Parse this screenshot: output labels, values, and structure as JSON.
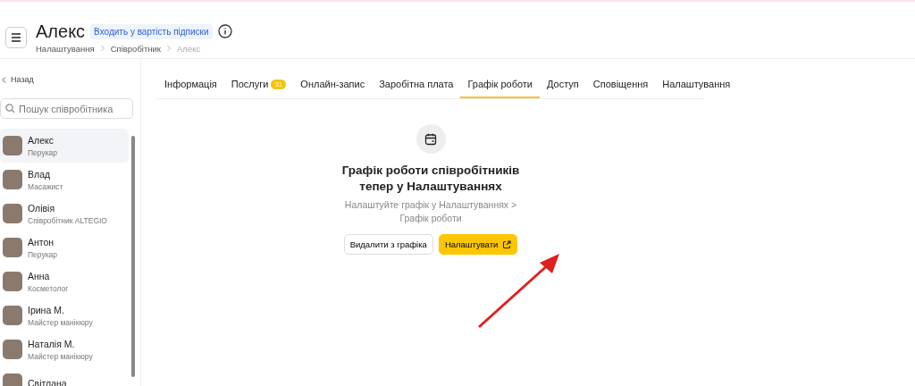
{
  "header": {
    "title": "Алекс",
    "badge": "Входить у вартість підписки",
    "breadcrumbs": [
      "Налаштування",
      "Співробітник",
      "Алекс"
    ]
  },
  "sidebar": {
    "back": "Назад",
    "search": {
      "placeholder": "Пошук співробітника"
    },
    "items": [
      {
        "name": "Алекс",
        "role": "Перукар",
        "selected": true
      },
      {
        "name": "Влад",
        "role": "Масажист",
        "selected": false
      },
      {
        "name": "Олівія",
        "role": "Співробітник ALTEGIO",
        "selected": false
      },
      {
        "name": "Антон",
        "role": "Перукар",
        "selected": false
      },
      {
        "name": "Анна",
        "role": "Косметолог",
        "selected": false
      },
      {
        "name": "Ірина М.",
        "role": "Майстер манікюру",
        "selected": false
      },
      {
        "name": "Наталія М.",
        "role": "Майстер манікюру",
        "selected": false
      },
      {
        "name": "Світлана",
        "selected": false
      }
    ]
  },
  "tabs": [
    {
      "label": "Інформація",
      "selected": false
    },
    {
      "label": "Послуги",
      "count": "31",
      "selected": false
    },
    {
      "label": "Онлайн-запис",
      "selected": false
    },
    {
      "label": "Заробітна плата",
      "selected": false
    },
    {
      "label": "Графік роботи",
      "selected": true
    },
    {
      "label": "Доступ",
      "selected": false
    },
    {
      "label": "Сповіщення",
      "selected": false
    },
    {
      "label": "Налаштування",
      "selected": false
    }
  ],
  "notice": {
    "title": "Графік роботи співробітників тепер у Налаштуваннях",
    "text": "Налаштуйте графік у Налаштуваннях > Графік роботи",
    "buttons": [
      {
        "label": "Видалити з графіка",
        "kind": "secondary"
      },
      {
        "label": "Налаштувати",
        "kind": "primary"
      }
    ]
  }
}
